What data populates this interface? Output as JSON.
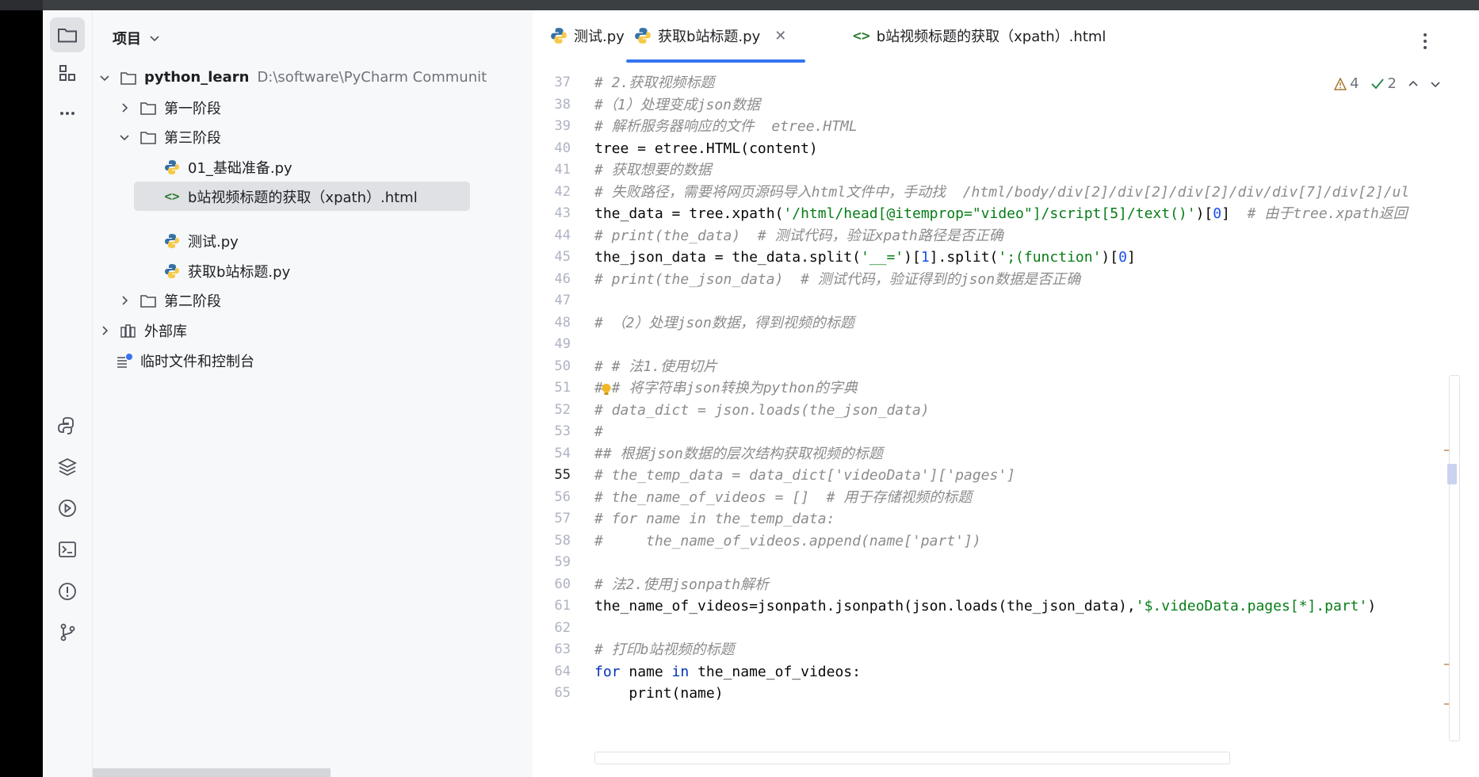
{
  "panel": {
    "title": "项目",
    "root_name": "python_learn",
    "root_path": "D:\\software\\PyCharm Communit",
    "items": [
      {
        "label": "第一阶段"
      },
      {
        "label": "第三阶段"
      },
      {
        "label": "01_基础准备.py"
      },
      {
        "label": "b站视频标题的获取（xpath）.html"
      },
      {
        "label": "测试.py"
      },
      {
        "label": "获取b站标题.py"
      },
      {
        "label": "第二阶段"
      },
      {
        "label": "外部库"
      },
      {
        "label": "临时文件和控制台"
      }
    ]
  },
  "tabs": [
    {
      "label": "测试.py"
    },
    {
      "label": "获取b站标题.py"
    },
    {
      "label": "b站视频标题的获取（xpath）.html"
    }
  ],
  "inspections": {
    "warnings": "4",
    "ok": "2"
  },
  "colors": {
    "accent": "#3574f0",
    "comment": "#8c8c8c",
    "keyword": "#0033b3",
    "string": "#067d17"
  },
  "code": {
    "line_numbers": [
      "37",
      "38",
      "39",
      "40",
      "41",
      "42",
      "43",
      "44",
      "45",
      "46",
      "47",
      "48",
      "49",
      "50",
      "51",
      "52",
      "53",
      "54",
      "55",
      "56",
      "57",
      "58",
      "59",
      "60",
      "61",
      "62",
      "63",
      "64",
      "65"
    ],
    "l37": "# 2.获取视频标题",
    "l38": "#（1）处理变成json数据",
    "l39": "# 解析服务器响应的文件  etree.HTML",
    "l40": "tree = etree.HTML(content)",
    "l41": "# 获取想要的数据",
    "l42": "# 失败路径，需要将网页源码导入html文件中，手动找  /html/body/div[2]/div[2]/div[2]/div/div[7]/div[2]/ul",
    "l43a": "the_data = tree.xpath(",
    "l43b": "'/html/head[@itemprop=\"video\"]/script[5]/text()'",
    "l43c": ")[",
    "l43d": "0",
    "l43e": "]  ",
    "l43f": "# 由于tree.xpath返回",
    "l44": "# print(the_data)  # 测试代码，验证xpath路径是否正确",
    "l45a": "the_json_data = the_data.split(",
    "l45b": "'__='",
    "l45c": ")[",
    "l45d": "1",
    "l45e": "].split(",
    "l45f": "';(function'",
    "l45g": ")[",
    "l45h": "0",
    "l45i": "]",
    "l46": "# print(the_json_data)  # 测试代码，验证得到的json数据是否正确",
    "l48": "# （2）处理json数据，得到视频的标题",
    "l50": "# # 法1.使用切片",
    "l51": "# # 将字符串json转换为python的字典",
    "l52": "# data_dict = json.loads(the_json_data)",
    "l53": "#",
    "l54": "## 根据json数据的层次结构获取视频的标题",
    "l55": "# the_temp_data = data_dict['videoData']['pages']",
    "l56": "# the_name_of_videos = []  # 用于存储视频的标题",
    "l57": "# for name in the_temp_data:",
    "l58": "#     the_name_of_videos.append(name['part'])",
    "l60": "# 法2.使用jsonpath解析",
    "l61a": "the_name_of_videos=jsonpath.jsonpath(json.loads(the_json_data),",
    "l61b": "'$.videoData.pages[*].part'",
    "l61c": ")",
    "l63": "# 打印b站视频的标题",
    "l64a": "for",
    "l64b": " name ",
    "l64c": "in",
    "l64d": " the_name_of_videos:",
    "l65": "    print(name)"
  }
}
